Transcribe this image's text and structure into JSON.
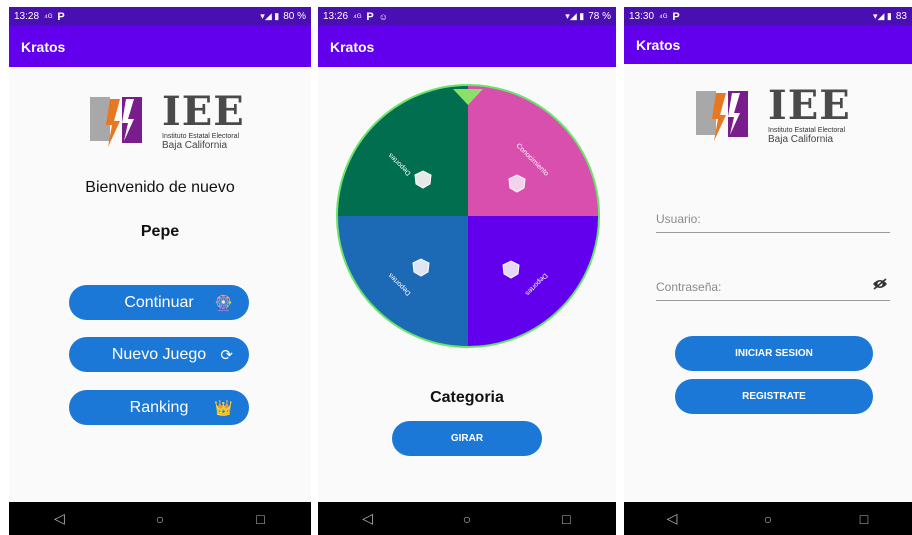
{
  "screens": [
    {
      "status": {
        "time": "13:28",
        "signal": "⁴ᴳ",
        "app_badge": "P",
        "battery_pct": "80 %",
        "sys_icons": "▾◢ ▮"
      },
      "app_title": "Kratos",
      "logo": {
        "big": "IEE",
        "line1": "Instituto Estatal Electoral",
        "line2": "Baja California"
      },
      "welcome": "Bienvenido de nuevo",
      "username": "Pepe",
      "buttons": [
        {
          "label": "Continuar",
          "icon": "🎡"
        },
        {
          "label": "Nuevo Juego",
          "icon": "⟳"
        },
        {
          "label": "Ranking",
          "icon": "👑"
        }
      ]
    },
    {
      "status": {
        "time": "13:26",
        "signal": "⁴ᴳ",
        "app_badge": "P",
        "extra": "☺",
        "battery_pct": "78 %",
        "sys_icons": "▾◢ ▮"
      },
      "app_title": "Kratos",
      "wheel": {
        "slices": [
          {
            "label": "Deportes",
            "color": "#006e4f"
          },
          {
            "label": "Conocimiento",
            "color": "#d94fae"
          },
          {
            "label": "Deportes",
            "color": "#6200ee"
          },
          {
            "label": "Deportes",
            "color": "#1c6ab5"
          }
        ],
        "rim_color": "#6be36b",
        "pointer_color": "#8be06a"
      },
      "category_label": "Categoria",
      "spin_button": "GIRAR"
    },
    {
      "status": {
        "time": "13:30",
        "signal": "⁴ᴳ",
        "app_badge": "P",
        "battery_pct": "83",
        "sys_icons": "▾◢ ▮"
      },
      "app_title": "Kratos",
      "logo": {
        "big": "IEE",
        "line1": "Instituto Estatal Electoral",
        "line2": "Baja California"
      },
      "user_placeholder": "Usuario:",
      "pass_placeholder": "Contraseña:",
      "login_button": "INICIAR SESION",
      "register_button": "REGISTRATE"
    }
  ],
  "nav": {
    "back": "◁",
    "home": "○",
    "recent": "□"
  }
}
